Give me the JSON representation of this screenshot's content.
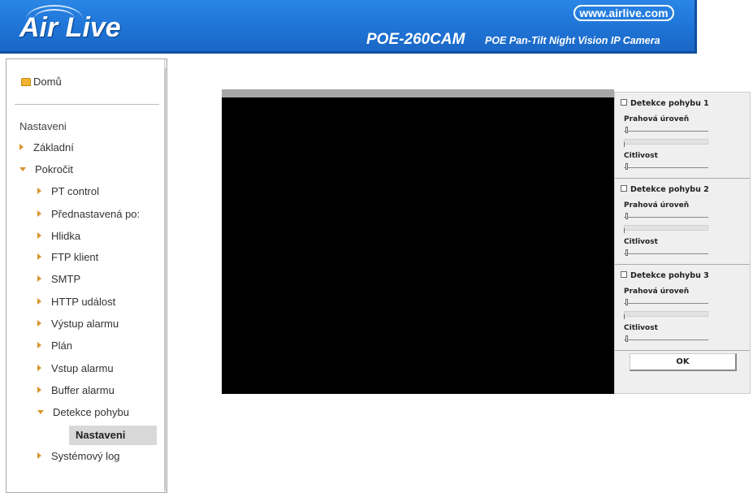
{
  "header": {
    "logo": "Air Live",
    "url": "www.airlive.com",
    "model": "POE-260CAM",
    "model_description": "POE Pan-Tilt Night Vision IP Camera"
  },
  "sidebar": {
    "home": "Domů",
    "section": "Nastaveni",
    "items": [
      {
        "label": "Základní",
        "level": 1,
        "expanded": false
      },
      {
        "label": "Pokročit",
        "level": 1,
        "expanded": true
      },
      {
        "label": "PT control",
        "level": 2,
        "expanded": false
      },
      {
        "label": "Přednastavená po:",
        "level": 2,
        "expanded": false
      },
      {
        "label": "Hlidka",
        "level": 2,
        "expanded": false
      },
      {
        "label": "FTP klient",
        "level": 2,
        "expanded": false
      },
      {
        "label": "SMTP",
        "level": 2,
        "expanded": false
      },
      {
        "label": "HTTP událost",
        "level": 2,
        "expanded": false
      },
      {
        "label": "Výstup alarmu",
        "level": 2,
        "expanded": false
      },
      {
        "label": "Plán",
        "level": 2,
        "expanded": false
      },
      {
        "label": "Vstup alarmu",
        "level": 2,
        "expanded": false
      },
      {
        "label": "Buffer alarmu",
        "level": 2,
        "expanded": false
      },
      {
        "label": "Detekce pohybu",
        "level": 2,
        "expanded": true
      },
      {
        "label": "Systémový log",
        "level": 1,
        "expanded": false
      }
    ],
    "selected": "Nastaveni"
  },
  "panel": {
    "boxes": [
      {
        "title": "Detekce pohybu 1",
        "threshold_label": "Prahová úroveň",
        "sensitivity_label": "Citlivost"
      },
      {
        "title": "Detekce pohybu 2",
        "threshold_label": "Prahová úroveň",
        "sensitivity_label": "Citlivost"
      },
      {
        "title": "Detekce pohybu 3",
        "threshold_label": "Prahová úroveň",
        "sensitivity_label": "Citlivost"
      }
    ],
    "ok_label": "OK"
  }
}
